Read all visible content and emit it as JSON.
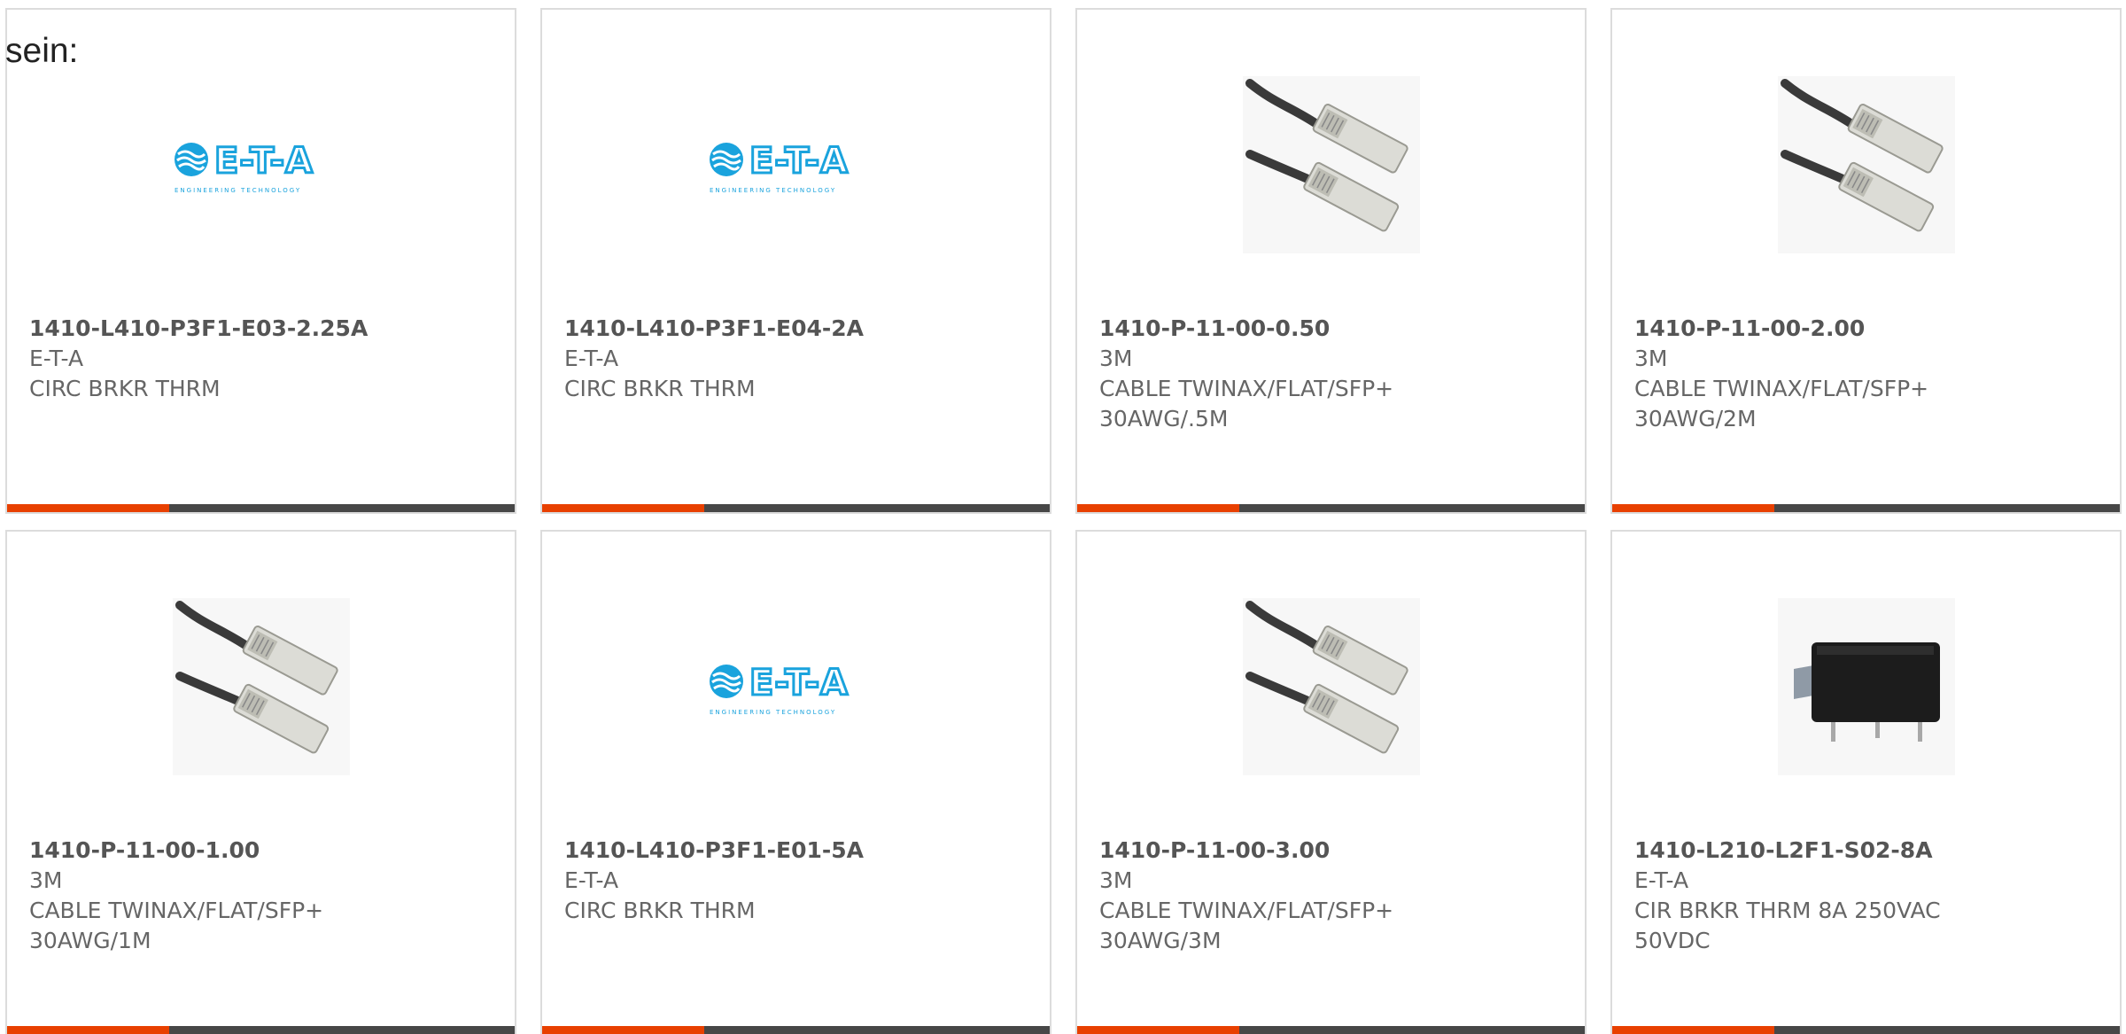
{
  "intro": {
    "text": "sein:"
  },
  "colors": {
    "accent": "#e84000",
    "bar": "#474747",
    "logo": "#1aa3dd"
  },
  "products": [
    {
      "part_number": "1410-L410-P3F1-E03-2.25A",
      "manufacturer": "E-T-A",
      "description": [
        "CIRC BRKR THRM"
      ],
      "image": "eta-logo",
      "logo_text": "E-T-A",
      "logo_tagline": "ENGINEERING TECHNOLOGY"
    },
    {
      "part_number": "1410-L410-P3F1-E04-2A",
      "manufacturer": "E-T-A",
      "description": [
        "CIRC BRKR THRM"
      ],
      "image": "eta-logo",
      "logo_text": "E-T-A",
      "logo_tagline": "ENGINEERING TECHNOLOGY"
    },
    {
      "part_number": "1410-P-11-00-0.50",
      "manufacturer": "3M",
      "description": [
        "CABLE TWINAX/FLAT/SFP+",
        "30AWG/.5M"
      ],
      "image": "sfp-cable"
    },
    {
      "part_number": "1410-P-11-00-2.00",
      "manufacturer": "3M",
      "description": [
        "CABLE TWINAX/FLAT/SFP+",
        "30AWG/2M"
      ],
      "image": "sfp-cable"
    },
    {
      "part_number": "1410-P-11-00-1.00",
      "manufacturer": "3M",
      "description": [
        "CABLE TWINAX/FLAT/SFP+",
        "30AWG/1M"
      ],
      "image": "sfp-cable"
    },
    {
      "part_number": "1410-L410-P3F1-E01-5A",
      "manufacturer": "E-T-A",
      "description": [
        "CIRC BRKR THRM"
      ],
      "image": "eta-logo",
      "logo_text": "E-T-A",
      "logo_tagline": "ENGINEERING TECHNOLOGY"
    },
    {
      "part_number": "1410-P-11-00-3.00",
      "manufacturer": "3M",
      "description": [
        "CABLE TWINAX/FLAT/SFP+",
        "30AWG/3M"
      ],
      "image": "sfp-cable"
    },
    {
      "part_number": "1410-L210-L2F1-S02-8A",
      "manufacturer": "E-T-A",
      "description": [
        "CIR BRKR THRM 8A 250VAC",
        "50VDC"
      ],
      "image": "circuit-breaker"
    }
  ]
}
